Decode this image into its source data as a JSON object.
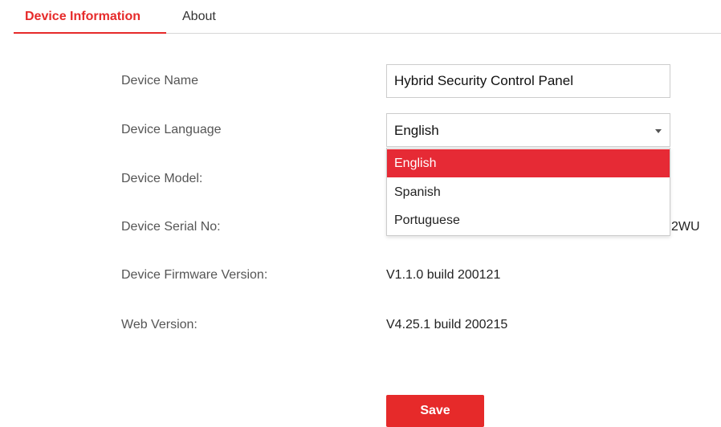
{
  "tabs": {
    "device_information": "Device Information",
    "about": "About"
  },
  "form": {
    "device_name_label": "Device Name",
    "device_name_value": "Hybrid Security Control Panel",
    "device_language_label": "Device Language",
    "device_language_value": "English",
    "device_model_label": "Device Model:",
    "device_serial_label": "Device Serial No:",
    "device_serial_visible_tail": "2WU",
    "firmware_label": "Device Firmware Version:",
    "firmware_value": "V1.1.0 build 200121",
    "web_version_label": "Web Version:",
    "web_version_value": "V4.25.1 build 200215"
  },
  "language_dropdown": {
    "options": [
      "English",
      "Spanish",
      "Portuguese"
    ],
    "selected": "English"
  },
  "actions": {
    "save_label": "Save"
  },
  "colors": {
    "accent": "#e62a2a",
    "selected_option_bg": "#e62a35",
    "label_text": "#555555"
  }
}
